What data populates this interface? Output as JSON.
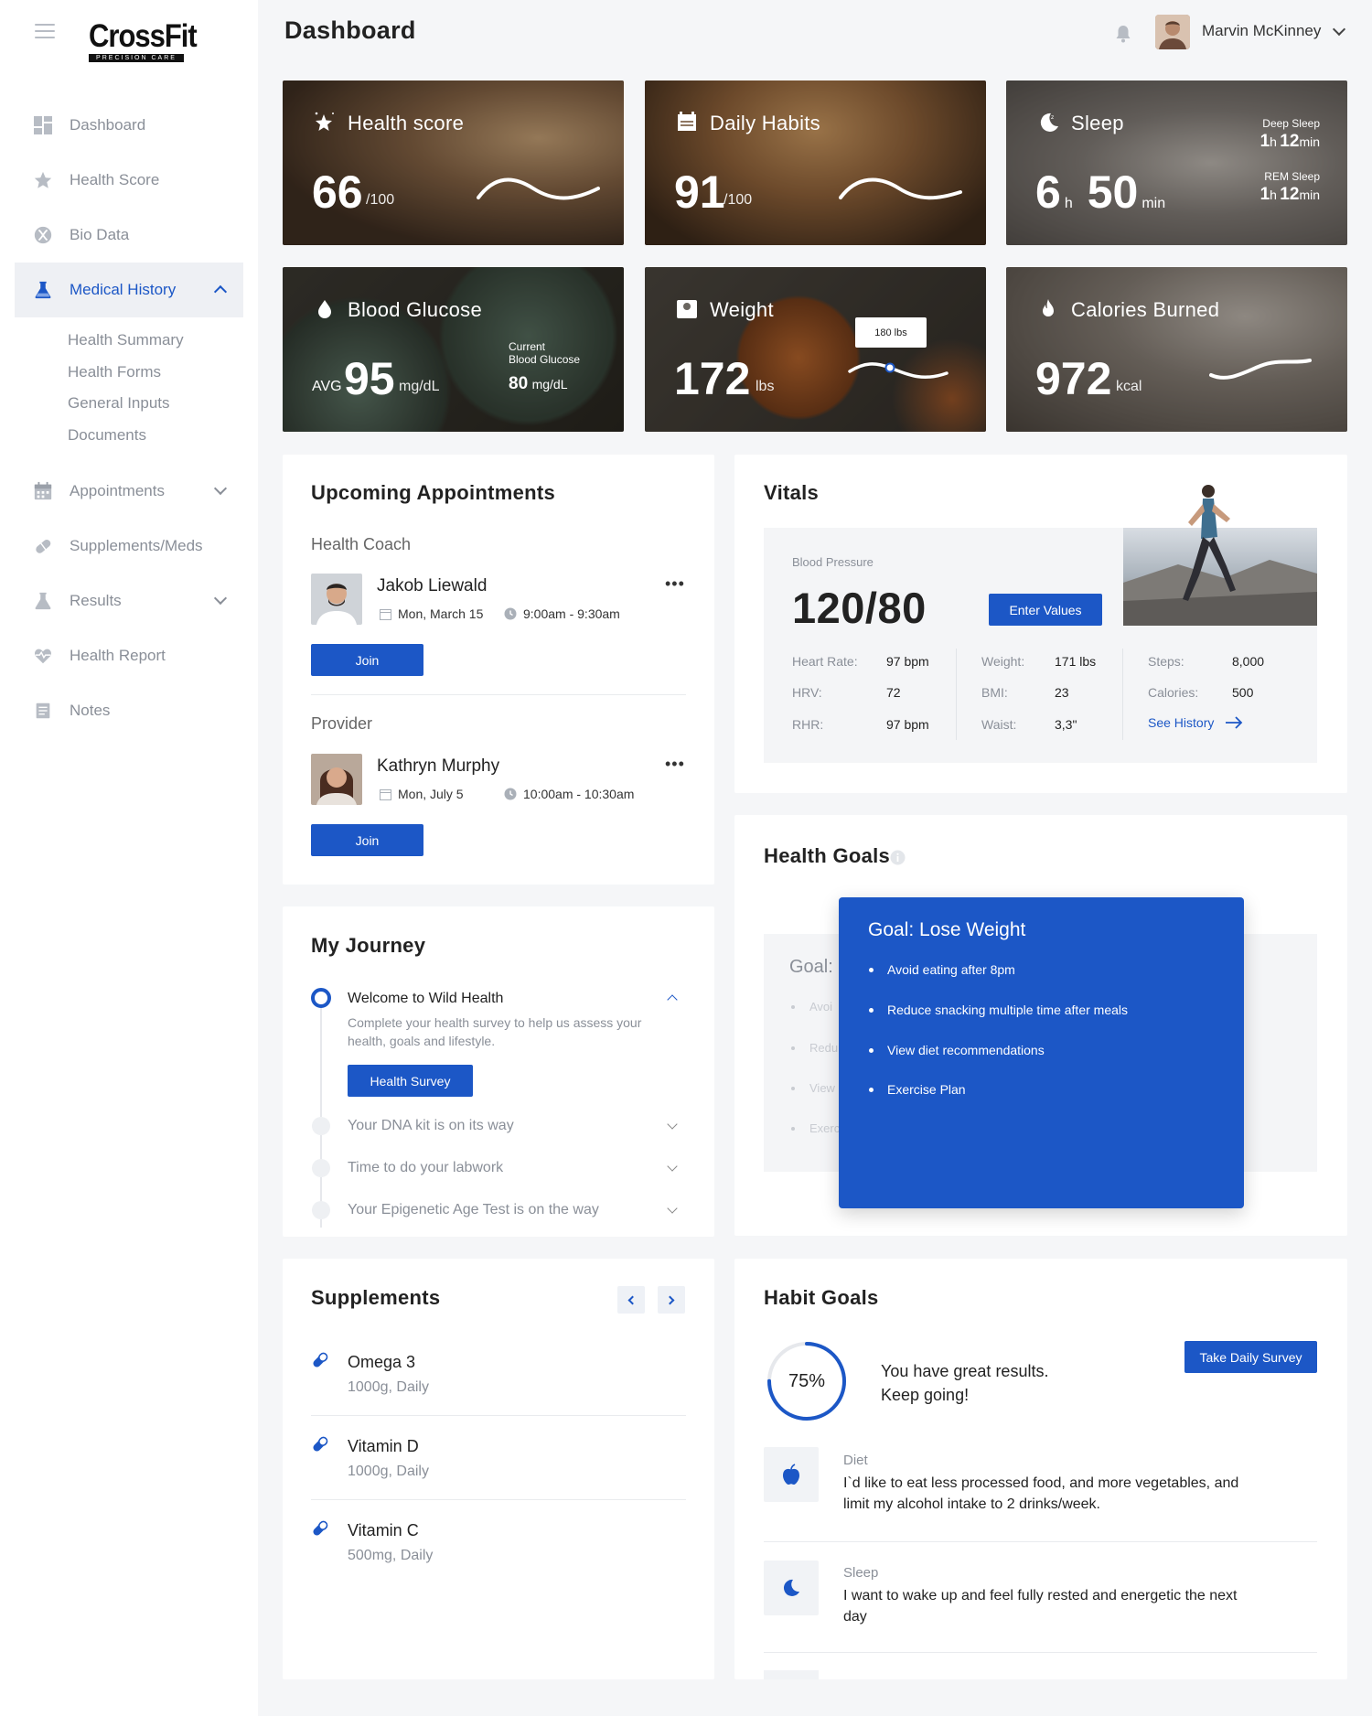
{
  "brand": {
    "name": "CrossFit",
    "tagline": "PRECISION CARE"
  },
  "sidebar": {
    "items": [
      {
        "label": "Dashboard",
        "icon": "dashboard-icon"
      },
      {
        "label": "Health Score",
        "icon": "star-icon"
      },
      {
        "label": "Bio Data",
        "icon": "biodata-icon"
      },
      {
        "label": "Medical History",
        "icon": "flask-icon",
        "active": true
      },
      {
        "label": "Appointments",
        "icon": "calendar-icon"
      },
      {
        "label": "Supplements/Meds",
        "icon": "pill-icon"
      },
      {
        "label": "Results",
        "icon": "flask-icon"
      },
      {
        "label": "Health Report",
        "icon": "heart-pulse-icon"
      },
      {
        "label": "Notes",
        "icon": "notes-icon"
      }
    ],
    "subitems": [
      "Health Summary",
      "Health Forms",
      "General Inputs",
      "Documents"
    ]
  },
  "header": {
    "title": "Dashboard",
    "user_name": "Marvin McKinney"
  },
  "tiles": {
    "health_score": {
      "title": "Health score",
      "value": "66",
      "unit": "/100"
    },
    "daily_habits": {
      "title": "Daily Habits",
      "value": "91",
      "unit": "/100"
    },
    "sleep": {
      "title": "Sleep",
      "hours": "6",
      "h": "h",
      "minutes": "50",
      "min": "min",
      "deep_label": "Deep Sleep",
      "deep_h": "1",
      "deep_m": "12",
      "rem_label": "REM Sleep",
      "rem_h": "1",
      "rem_m": "12"
    },
    "blood_glucose": {
      "title": "Blood Glucose",
      "avg_label": "AVG",
      "value": "95",
      "unit": "mg/dL",
      "current_label_1": "Current",
      "current_label_2": "Blood Glucose",
      "current_value": "80",
      "current_unit": "mg/dL"
    },
    "weight": {
      "title": "Weight",
      "value": "172",
      "unit": "lbs",
      "tooltip": "180 lbs"
    },
    "calories": {
      "title": "Calories Burned",
      "value": "972",
      "unit": "kcal"
    }
  },
  "appointments": {
    "title": "Upcoming Appointments",
    "items": [
      {
        "role": "Health Coach",
        "name": "Jakob Liewald",
        "date": "Mon, March 15",
        "time": "9:00am - 9:30am",
        "button": "Join"
      },
      {
        "role": "Provider",
        "name": "Kathryn Murphy",
        "date": "Mon, July 5",
        "time": "10:00am - 10:30am",
        "button": "Join"
      }
    ],
    "more": "•••"
  },
  "vitals": {
    "title": "Vitals",
    "bp_label": "Blood Pressure",
    "bp_value": "120/80",
    "enter_button": "Enter Values",
    "col1": [
      {
        "label": "Heart Rate:",
        "value": "97 bpm"
      },
      {
        "label": "HRV:",
        "value": "72"
      },
      {
        "label": "RHR:",
        "value": "97 bpm"
      }
    ],
    "col2": [
      {
        "label": "Weight:",
        "value": "171 lbs"
      },
      {
        "label": "BMI:",
        "value": "23"
      },
      {
        "label": "Waist:",
        "value": "3,3\""
      }
    ],
    "col3": [
      {
        "label": "Steps:",
        "value": "8,000"
      },
      {
        "label": "Calories:",
        "value": "500"
      }
    ],
    "see_history": "See History"
  },
  "journey": {
    "title": "My Journey",
    "active": {
      "title": "Welcome to Wild Health",
      "desc_1": "Complete your health survey to help us assess your",
      "desc_2": "health, goals and lifestyle.",
      "button": "Health Survey"
    },
    "items": [
      "Your DNA kit is on its way",
      "Time to do your labwork",
      "Your Epigenetic Age Test is on the way"
    ]
  },
  "health_goals": {
    "title": "Health Goals",
    "background_label": "Goal:",
    "background_items": [
      "Avoi",
      "Redu",
      "View",
      "Exerc"
    ],
    "popup_title": "Goal: Lose Weight",
    "popup_items": [
      "Avoid eating after 8pm",
      "Reduce snacking multiple time after meals",
      "View diet recommendations",
      "Exercise Plan"
    ]
  },
  "supplements": {
    "title": "Supplements",
    "items": [
      {
        "name": "Omega 3",
        "dose": "1000g, Daily"
      },
      {
        "name": "Vitamin D",
        "dose": "1000g, Daily"
      },
      {
        "name": "Vitamin C",
        "dose": "500mg, Daily"
      }
    ]
  },
  "habit_goals": {
    "title": "Habit Goals",
    "progress": 0.75,
    "progress_label": "75%",
    "message_1": "You have great results.",
    "message_2": "Keep going!",
    "survey_button": "Take Daily Survey",
    "items": [
      {
        "category": "Diet",
        "text_1": "I`d like to eat less processed food, and more vegetables, and",
        "text_2": "limit my alcohol intake to 2 drinks/week."
      },
      {
        "category": "Sleep",
        "text_1": "I want to wake up and feel fully rested and energetic the next",
        "text_2": "day"
      }
    ]
  },
  "colors": {
    "accent": "#1c57c6",
    "sidebar_active_bg": "#eef0f4",
    "muted_text": "#8a8f98"
  }
}
